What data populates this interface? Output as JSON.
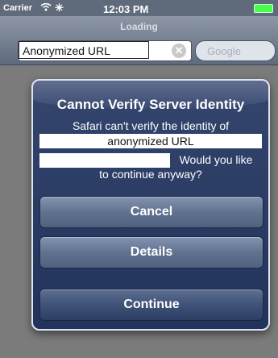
{
  "status_bar": {
    "carrier": "Carrier",
    "time": "12:03 PM",
    "wifi_icon": "wifi-icon",
    "activity_icon": "activity-spinner-icon",
    "battery_icon": "battery-icon"
  },
  "nav": {
    "title": "Loading",
    "url_value": "Anonymized URL",
    "clear_symbol": "✕",
    "search_placeholder": "Google"
  },
  "dialog": {
    "title": "Cannot Verify Server Identity",
    "message_line1": "Safari can't verify the identity of",
    "redacted_url": "anonymized URL",
    "message_line2": "Would you like",
    "message_line3": "to continue anyway?",
    "buttons": {
      "cancel": "Cancel",
      "details": "Details",
      "continue": "Continue"
    }
  }
}
